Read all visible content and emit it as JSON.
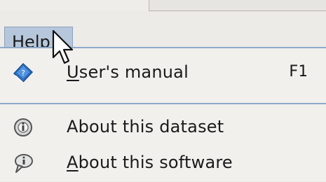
{
  "menubar": {
    "help": {
      "mnemonic": "H",
      "rest": "elp"
    }
  },
  "menu": {
    "items": [
      {
        "icon": "book-help-icon",
        "mnemonic": "U",
        "rest": "ser's manual",
        "shortcut": "F1"
      },
      {
        "icon": "database-info-icon",
        "label": "About this dataset"
      },
      {
        "icon": "speech-bubble-info-icon",
        "mnemonic": "A",
        "rest": "bout this software"
      }
    ]
  },
  "colors": {
    "menu_highlight": "#b7c7db",
    "separator": "#8ea9c9",
    "book_icon": "#2f6fc0"
  }
}
